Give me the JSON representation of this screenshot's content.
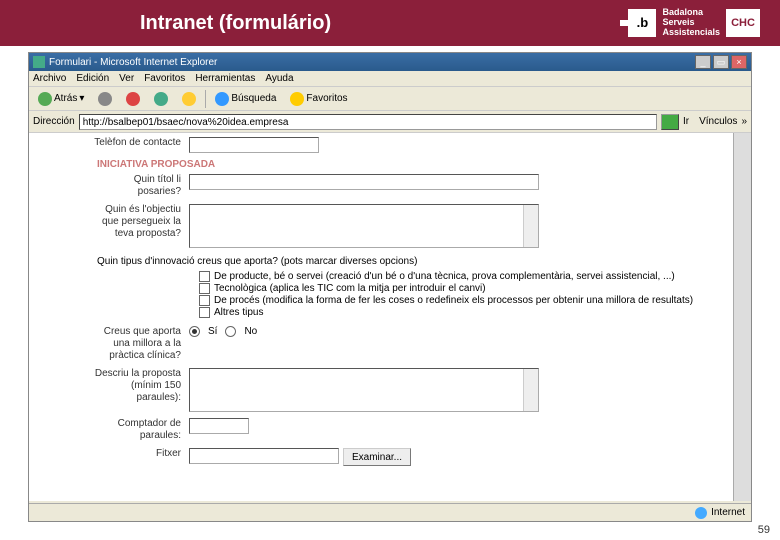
{
  "slide": {
    "title": "Intranet (formulário)",
    "page_number": "59"
  },
  "logo": {
    "brand_lines": "Badalona\nServeis\nAssistencials",
    "b": ".b",
    "chc": "CHC"
  },
  "browser": {
    "window_title": "Formulari - Microsoft Internet Explorer",
    "menu": {
      "archivo": "Archivo",
      "edicion": "Edición",
      "ver": "Ver",
      "favoritos": "Favoritos",
      "herramientas": "Herramientas",
      "ayuda": "Ayuda"
    },
    "toolbar": {
      "back": "Atrás",
      "search": "Búsqueda",
      "favorites": "Favoritos"
    },
    "address": {
      "label": "Dirección",
      "value": "http://bsalbep01/bsaec/nova%20idea.empresa",
      "go": "Ir",
      "links": "Vínculos"
    },
    "status": {
      "left": "",
      "right": "Internet"
    }
  },
  "form": {
    "telefon_label": "Telèfon de contacte",
    "section_iniciativa": "INICIATIVA PROPOSADA",
    "titol_label": "Quin títol li posaries?",
    "objectiu_label": "Quin és l'objectiu que persegueix la teva proposta?",
    "tipus_question": "Quin tipus d'innovació creus que aporta? (pots marcar diverses opcions)",
    "chk1": "De producte, bé o servei (creació d'un bé o d'una tècnica, prova complementària, servei assistencial, ...)",
    "chk2": "Tecnològica (aplica les TIC com la mitja per introduir el canvi)",
    "chk3": "De procés (modifica la forma de fer les coses o redefineix els processos per obtenir una millora de resultats)",
    "chk4": "Altres tipus",
    "millora_label": "Creus que aporta una millora a la pràctica clínica?",
    "radio_si": "Sí",
    "radio_no": "No",
    "descriu_label": "Descriu la proposta (mínim 150 paraules):",
    "comptador_label": "Comptador de paraules:",
    "fitxer_label": "Fitxer",
    "examinar": "Examinar..."
  }
}
